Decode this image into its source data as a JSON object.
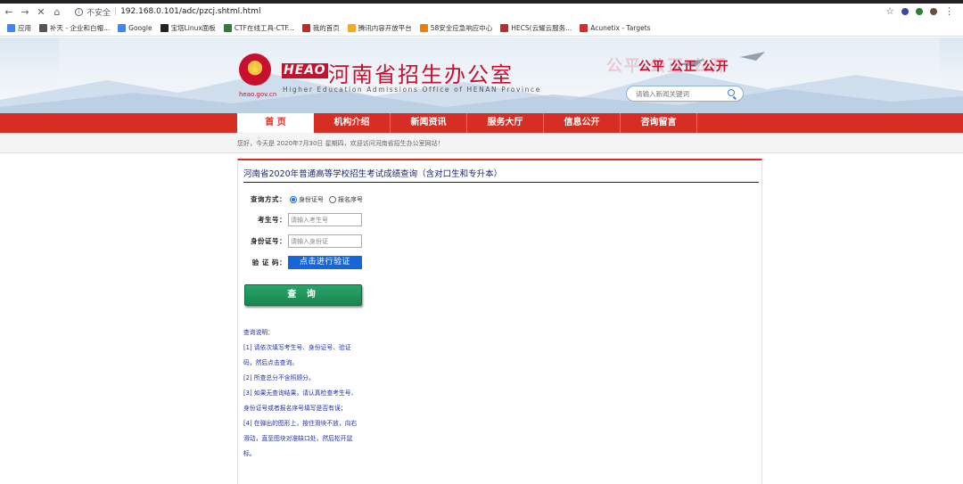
{
  "browser": {
    "back_icon": "←",
    "forward_icon": "→",
    "stop_icon": "✕",
    "home_icon": "⌂",
    "security_label": "不安全",
    "url_separator": "|",
    "url": "192.168.0.101/adc/pzcj.shtml.html",
    "star_icon": "☆",
    "menu_icon": "⋮"
  },
  "bookmarks": [
    {
      "label": "应用",
      "icon": "apps-icon",
      "color": "#4285f4"
    },
    {
      "label": "补天 - 企业和白帽...",
      "icon": "butian-icon",
      "color": "#555555"
    },
    {
      "label": "Google",
      "icon": "google-icon",
      "color": "#4285f4"
    },
    {
      "label": "宝塔Linux面板",
      "icon": "bt-icon",
      "color": "#222222"
    },
    {
      "label": "CTF在线工具-CTF...",
      "icon": "ctf-icon",
      "color": "#2e7d32"
    },
    {
      "label": "我的首页",
      "icon": "home-page-icon",
      "color": "#c62828"
    },
    {
      "label": "腾讯内容开放平台",
      "icon": "tencent-icon",
      "color": "#f9a825"
    },
    {
      "label": "58安全应急响应中心",
      "icon": "58-icon",
      "color": "#f57c00"
    },
    {
      "label": "HECS(云耀云服务...",
      "icon": "huawei-icon",
      "color": "#c62828"
    },
    {
      "label": "Acunetix - Targets",
      "icon": "acunetix-icon",
      "color": "#d32f2f"
    }
  ],
  "header": {
    "emblem_glyph": "★",
    "domain": "heao.gov.cn",
    "logo_tag": "HEAO",
    "title": "河南省招生办公室",
    "subtitle": "Higher Education Admissions Office of HENAN Province",
    "slogan": "公平 公正 公开",
    "search_placeholder": "请输入新闻关键词"
  },
  "nav": {
    "items": [
      {
        "label": "首 页",
        "active": true
      },
      {
        "label": "机构介绍",
        "active": false
      },
      {
        "label": "新闻资讯",
        "active": false
      },
      {
        "label": "服务大厅",
        "active": false
      },
      {
        "label": "信息公开",
        "active": false
      },
      {
        "label": "咨询留言",
        "active": false
      }
    ]
  },
  "welcome": "您好，今天是 2020年7月30日 星期四，欢迎访问河南省招生办公室网站！",
  "form": {
    "title": "河南省2020年普通高等学校招生考试成绩查询（含对口生和专升本）",
    "mode_label": "查询方式：",
    "mode_options": [
      "身份证号",
      "报名序号"
    ],
    "mode_selected": "身份证号",
    "exam_no_label": "考生号：",
    "exam_no_placeholder": "请输入考生号",
    "id_label": "身份证号：",
    "id_placeholder": "请输入身份证",
    "captcha_label": "验 证 码：",
    "verify_button": "点击进行验证",
    "submit_button": "查 询"
  },
  "notes": [
    "查询说明：",
    "[1] 请依次填写考生号、身份证号、验证",
    "码，然后点击查询。",
    "[2] 所查总分不含照顾分。",
    "[3] 如果无查询结果，请认真检查考生号、",
    "身份证号或者报名序号填写是否有误；",
    "[4] 在弹出的图形上，按住滑块不放，向右",
    "滑动，直至图块对准缺口处，然后松开鼠",
    "标。"
  ],
  "colors": {
    "brand_red": "#d62e24",
    "title_red": "#c8102e",
    "verify_blue": "#1766d6",
    "submit_green": "#17874f",
    "note_blue": "#2233aa"
  }
}
